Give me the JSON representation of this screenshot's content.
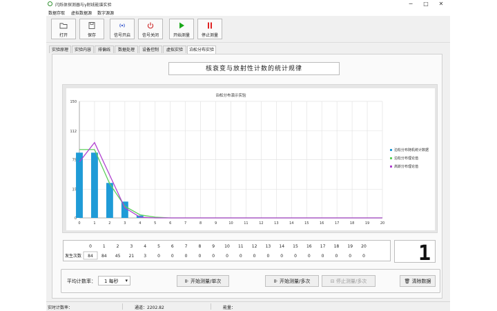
{
  "window": {
    "title": "闪烁体探测器与γ射线能谱实验",
    "minimize": "−",
    "maximize": "□",
    "close": "✕"
  },
  "menu": [
    "数据存取",
    "虚拟数据源",
    "数字源源"
  ],
  "toolbar": [
    {
      "label": "打开",
      "icon": "folder-icon"
    },
    {
      "label": "保存",
      "icon": "save-icon"
    },
    {
      "label": "信号开启",
      "icon": "signal-icon"
    },
    {
      "label": "信号关闭",
      "icon": "power-icon"
    },
    {
      "label": "开始测量",
      "icon": "play-icon"
    },
    {
      "label": "停止测量",
      "icon": "pause-icon"
    }
  ],
  "tabs": [
    "实验原理",
    "实验内容",
    "排偏线",
    "数据处理",
    "设备控制",
    "虚拟实验",
    "泊松分布实验"
  ],
  "active_tab": 6,
  "page_title": "核衰变与放射性计数的统计规律",
  "colors": {
    "bar": "#1f9bd7",
    "green": "#5ccf5a",
    "purple": "#b040d0"
  },
  "chart_data": {
    "type": "bar",
    "title": "泊松分布演示实验",
    "x": [
      0,
      1,
      2,
      3,
      4,
      5,
      6,
      7,
      8,
      9,
      10,
      11,
      12,
      13,
      14,
      15,
      16,
      17,
      18,
      19,
      20
    ],
    "x_ticks": [
      "0",
      "1",
      "2",
      "3",
      "4",
      "5",
      "6",
      "7",
      "8",
      "9",
      "10",
      "11",
      "12",
      "13",
      "14",
      "15",
      "16",
      "17",
      "18",
      "19",
      "20"
    ],
    "ylim": [
      0,
      150
    ],
    "y_ticks": [
      "0",
      "37",
      "75",
      "112",
      "150"
    ],
    "grid": true,
    "legend_position": "right",
    "series": [
      {
        "name": "泊松分布随机统计数据",
        "type": "bar",
        "color": "#1f9bd7",
        "values": [
          84,
          84,
          45,
          21,
          3,
          0,
          0,
          0,
          0,
          0,
          0,
          0,
          0,
          0,
          0,
          0,
          0,
          0,
          0,
          0,
          0
        ]
      },
      {
        "name": "泊松分布理论值",
        "type": "line",
        "color": "#5ccf5a",
        "values": [
          88,
          88,
          44,
          15,
          4,
          1,
          0,
          0,
          0,
          0,
          0,
          0,
          0,
          0,
          0,
          0,
          0,
          0,
          0,
          0,
          0
        ]
      },
      {
        "name": "高斯分布理论值",
        "type": "line",
        "color": "#b040d0",
        "values": [
          72,
          97,
          55,
          13,
          1,
          0,
          0,
          0,
          0,
          0,
          0,
          0,
          0,
          0,
          0,
          0,
          0,
          0,
          0,
          0,
          0
        ]
      }
    ]
  },
  "count_table": {
    "row_label": "发生次数",
    "headers": [
      "0",
      "1",
      "2",
      "3",
      "4",
      "5",
      "6",
      "7",
      "8",
      "9",
      "10",
      "11",
      "12",
      "13",
      "14",
      "15",
      "16",
      "17",
      "18",
      "19",
      "20"
    ],
    "values": [
      "84",
      "84",
      "45",
      "21",
      "3",
      "0",
      "0",
      "0",
      "0",
      "0",
      "0",
      "0",
      "0",
      "0",
      "0",
      "0",
      "0",
      "0",
      "0",
      "0",
      "0"
    ]
  },
  "digit_display": "1",
  "controls": {
    "rate_label": "平均计数率：",
    "rate_value": "1 每秒",
    "single_btn": "开始测量/单次",
    "multi_btn": "开始测量/多次",
    "stop_btn": "停止测量/多次",
    "clear_btn": "清除数据"
  },
  "status": {
    "left": "实时计数率：",
    "mid": "通道：2202.82",
    "right": "能量："
  }
}
